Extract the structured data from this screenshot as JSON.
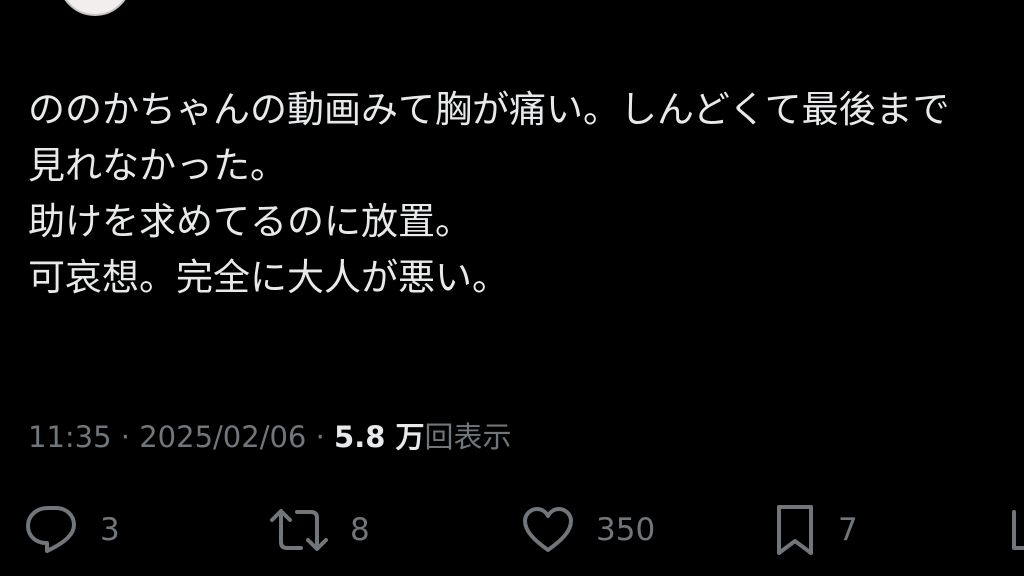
{
  "tweet": {
    "lines": [
      "ののかちゃんの動画みて胸が痛い。しんどくて最後まで",
      "見れなかった。",
      "助けを求めてるのに放置。",
      "可哀想。完全に大人が悪い。"
    ],
    "meta": {
      "time": "11:35",
      "separator": " · ",
      "date": "2025/02/06",
      "views_count": "5.8 万",
      "views_label": "回表示"
    }
  },
  "actions": {
    "reply_count": "3",
    "retweet_count": "8",
    "like_count": "350",
    "bookmark_count": "7"
  },
  "icons": {
    "reply": "speech-bubble-icon",
    "retweet": "retweet-arrows-icon",
    "like": "heart-icon",
    "bookmark": "bookmark-icon",
    "share": "share-icon"
  },
  "colors": {
    "background": "#000000",
    "text": "#e7e9ea",
    "secondary": "#71767b"
  }
}
